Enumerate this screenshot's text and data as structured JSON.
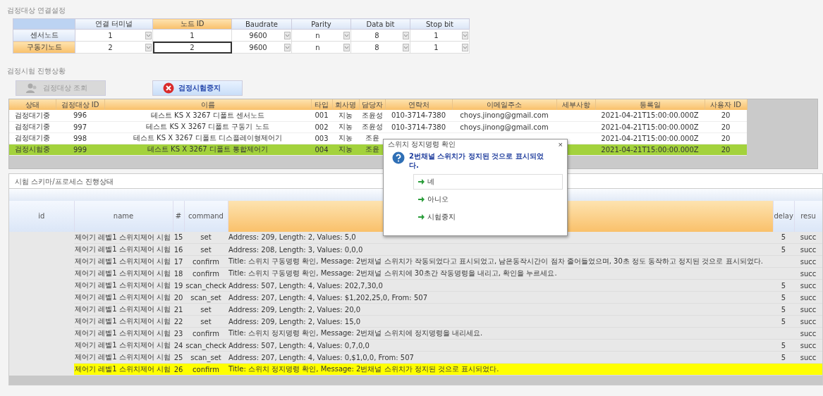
{
  "connection": {
    "title": "검정대상 연결설정",
    "columns": [
      {
        "label": "연결 터미널",
        "selected": false
      },
      {
        "label": "노드 ID",
        "selected": true
      },
      {
        "label": "Baudrate",
        "selected": false
      },
      {
        "label": "Parity",
        "selected": false
      },
      {
        "label": "Data bit",
        "selected": false
      },
      {
        "label": "Stop bit",
        "selected": false
      }
    ],
    "rows": [
      {
        "label": "센서노드",
        "selected": false,
        "cells": [
          {
            "value": "1",
            "dropdown": true,
            "editing": false
          },
          {
            "value": "1",
            "dropdown": false,
            "editing": false
          },
          {
            "value": "9600",
            "dropdown": true,
            "editing": false
          },
          {
            "value": "n",
            "dropdown": true,
            "editing": false
          },
          {
            "value": "8",
            "dropdown": true,
            "editing": false
          },
          {
            "value": "1",
            "dropdown": true,
            "editing": false
          }
        ]
      },
      {
        "label": "구동기노드",
        "selected": true,
        "cells": [
          {
            "value": "2",
            "dropdown": true,
            "editing": false
          },
          {
            "value": "2",
            "dropdown": false,
            "editing": true
          },
          {
            "value": "9600",
            "dropdown": true,
            "editing": false
          },
          {
            "value": "n",
            "dropdown": true,
            "editing": false
          },
          {
            "value": "8",
            "dropdown": true,
            "editing": false
          },
          {
            "value": "1",
            "dropdown": true,
            "editing": false
          }
        ]
      }
    ]
  },
  "progress": {
    "title": "검정시험 진행상황",
    "buttons": [
      {
        "label": "검정대상 조회",
        "kind": "search",
        "disabled": true
      },
      {
        "label": "검정시험중지",
        "kind": "stop",
        "disabled": false
      }
    ],
    "columns": [
      "상태",
      "검정대상 ID",
      "이름",
      "타입",
      "회사명",
      "담당자",
      "연락처",
      "이메일주소",
      "세부사항",
      "등록일",
      "사용자 ID"
    ],
    "rows": [
      {
        "selected": false,
        "cells": [
          "검정대기중",
          "996",
          "테스트 KS X 3267 디폴트 센서노드",
          "001",
          "지농",
          "조윤성",
          "010-3714-7380",
          "choys.jinong@gmail.com",
          "",
          "2021-04-21T15:00:00.000Z",
          "20"
        ]
      },
      {
        "selected": false,
        "cells": [
          "검정대기중",
          "997",
          "테스트 KS X 3267 디폴트 구동기 노드",
          "002",
          "지농",
          "조윤성",
          "010-3714-7380",
          "choys.jinong@gmail.com",
          "",
          "2021-04-21T15:00:00.000Z",
          "20"
        ]
      },
      {
        "selected": false,
        "cells": [
          "검정대기중",
          "998",
          "테스트 KS X 3267 디폴트 디스플레이형제어기",
          "003",
          "지농",
          "조윤",
          "",
          "",
          "",
          "2021-04-21T15:00:00.000Z",
          "20"
        ]
      },
      {
        "selected": true,
        "cells": [
          "검정시험중",
          "999",
          "테스트 KS X 3267 디폴트 통합제어기",
          "004",
          "지농",
          "조윤",
          "",
          "",
          "",
          "2021-04-21T15:00:00.000Z",
          "20"
        ]
      }
    ]
  },
  "schema": {
    "title": "시험 스키마/프로세스 진행상태",
    "columns": [
      {
        "label": "id",
        "highlighted": false
      },
      {
        "label": "name",
        "highlighted": false
      },
      {
        "label": "#",
        "highlighted": false
      },
      {
        "label": "command",
        "highlighted": false
      },
      {
        "highlighted": true
      },
      {
        "label": "delay",
        "highlighted": false
      },
      {
        "label": "resu",
        "highlighted": false
      }
    ],
    "rows": [
      {
        "highlighted": false,
        "cells": [
          "",
          "제어기 레벨1 스위치제어 시험",
          "15",
          "set",
          "Address: 209, Length: 2, Values: 5,0",
          "5",
          "succ"
        ]
      },
      {
        "highlighted": false,
        "cells": [
          "",
          "제어기 레벨1 스위치제어 시험",
          "16",
          "set",
          "Address: 208, Length: 3, Values: 0,0,0",
          "5",
          "succ"
        ]
      },
      {
        "highlighted": false,
        "cells": [
          "",
          "제어기 레벨1 스위치제어 시험",
          "17",
          "confirm",
          "Title: 스위치 구동명령 확인, Message: 2번채널 스위치가 작동되었다고 표시되었고, 남은동작시간이 점차 줄어들었으며, 30초 정도 동작하고 정지된 것으로 표시되었다.",
          "",
          "succ"
        ]
      },
      {
        "highlighted": false,
        "cells": [
          "",
          "제어기 레벨1 스위치제어 시험",
          "18",
          "confirm",
          "Title: 스위치 구동명령 확인, Message: 2번채널 스위치에 30초간 작동명령을 내리고, 확인을 누르세요.",
          "",
          "succ"
        ]
      },
      {
        "highlighted": false,
        "cells": [
          "",
          "제어기 레벨1 스위치제어 시험",
          "19",
          "scan_check",
          "Address: 507, Length: 4, Values: 202,7,30,0",
          "5",
          "succ"
        ]
      },
      {
        "highlighted": false,
        "cells": [
          "",
          "제어기 레벨1 스위치제어 시험",
          "20",
          "scan_set",
          "Address: 207, Length: 4, Values: $1,202,25,0, From: 507",
          "5",
          "succ"
        ]
      },
      {
        "highlighted": false,
        "cells": [
          "",
          "제어기 레벨1 스위치제어 시험",
          "21",
          "set",
          "Address: 209, Length: 2, Values: 20,0",
          "5",
          "succ"
        ]
      },
      {
        "highlighted": false,
        "cells": [
          "",
          "제어기 레벨1 스위치제어 시험",
          "22",
          "set",
          "Address: 209, Length: 2, Values: 15,0",
          "5",
          "succ"
        ]
      },
      {
        "highlighted": false,
        "cells": [
          "",
          "제어기 레벨1 스위치제어 시험",
          "23",
          "confirm",
          "Title: 스위치 정지명령 확인, Message: 2번채널 스위치에 정지명령을 내리세요.",
          "",
          "succ"
        ]
      },
      {
        "highlighted": false,
        "cells": [
          "",
          "제어기 레벨1 스위치제어 시험",
          "24",
          "scan_check",
          "Address: 507, Length: 4, Values: 0,7,0,0",
          "5",
          "succ"
        ]
      },
      {
        "highlighted": false,
        "cells": [
          "",
          "제어기 레벨1 스위치제어 시험",
          "25",
          "scan_set",
          "Address: 207, Length: 4, Values: 0,$1,0,0, From: 507",
          "5",
          "succ"
        ]
      },
      {
        "highlighted": true,
        "cells": [
          "",
          "제어기 레벨1 스위치제어 시험",
          "26",
          "confirm",
          "Title: 스위치 정지명령 확인, Message: 2번채널 스위치가 정지된 것으로 표시되었다.",
          "",
          ""
        ]
      }
    ]
  },
  "dialog": {
    "title": "스위치 정지명령 확인",
    "close": "×",
    "message": "2번채널 스위치가 정지된 것으로 표시되었다.",
    "options": [
      {
        "label": "네",
        "selected": true
      },
      {
        "label": "아니오",
        "selected": false
      },
      {
        "label": "시험중지",
        "selected": false
      }
    ]
  }
}
